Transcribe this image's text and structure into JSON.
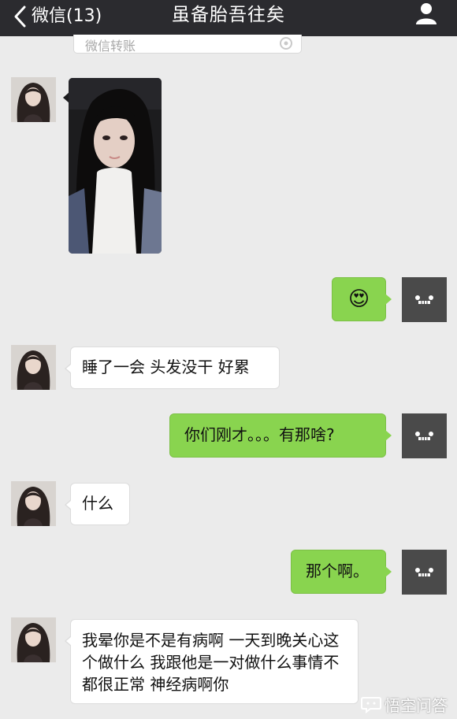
{
  "header": {
    "back_label": "微信(13)",
    "title": "虽备胎吾往矣"
  },
  "transfer_card": {
    "label": "微信转账"
  },
  "messages": [
    {
      "side": "left",
      "type": "image",
      "content": "selfie photo"
    },
    {
      "side": "right",
      "type": "emoji",
      "content": "😍"
    },
    {
      "side": "left",
      "type": "text",
      "content": "睡了一会 头发没干 好累"
    },
    {
      "side": "right",
      "type": "text",
      "content": "你们刚才。。。有那啥?"
    },
    {
      "side": "left",
      "type": "text",
      "content": "什么"
    },
    {
      "side": "right",
      "type": "text",
      "content": "那个啊。"
    },
    {
      "side": "left",
      "type": "text",
      "content": "我晕你是不是有病啊 一天到晚关心这个做什么 我跟他是一对做什么事情不都很正常 神经病啊你"
    }
  ],
  "watermark": "悟空问答",
  "colors": {
    "header_bg": "#2b2b2f",
    "chat_bg": "#ebebeb",
    "sent_bubble": "#89d44f",
    "received_bubble": "#ffffff"
  }
}
